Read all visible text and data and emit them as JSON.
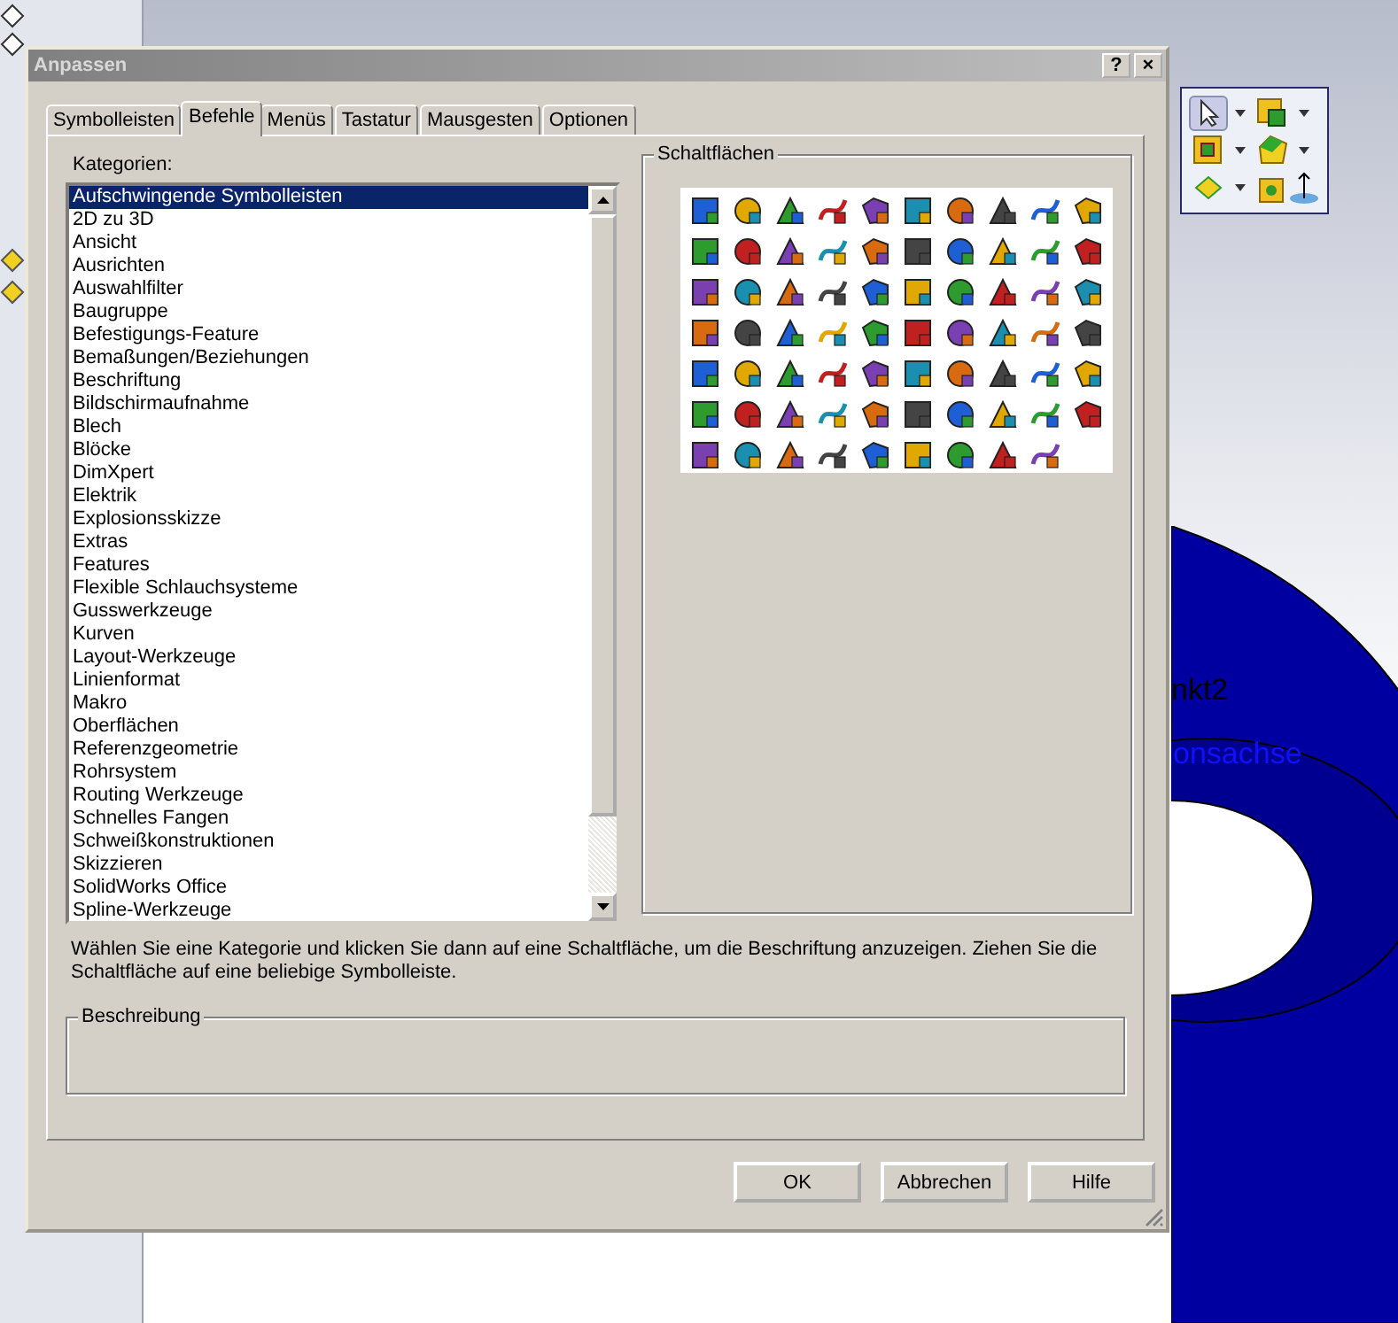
{
  "window": {
    "title": "Anpassen",
    "help_button": "?",
    "close_button": "×"
  },
  "tabs": [
    {
      "label": "Symbolleisten",
      "selected": false
    },
    {
      "label": "Befehle",
      "selected": true
    },
    {
      "label": "Menüs",
      "selected": false
    },
    {
      "label": "Tastatur",
      "selected": false
    },
    {
      "label": "Mausgesten",
      "selected": false
    },
    {
      "label": "Optionen",
      "selected": false
    }
  ],
  "categories_label": "Kategorien:",
  "categories": [
    {
      "label": "Aufschwingende Symbolleisten",
      "selected": true
    },
    {
      "label": "2D zu 3D",
      "selected": false
    },
    {
      "label": "Ansicht",
      "selected": false
    },
    {
      "label": "Ausrichten",
      "selected": false
    },
    {
      "label": "Auswahlfilter",
      "selected": false
    },
    {
      "label": "Baugruppe",
      "selected": false
    },
    {
      "label": "Befestigungs-Feature",
      "selected": false
    },
    {
      "label": "Bemaßungen/Beziehungen",
      "selected": false
    },
    {
      "label": "Beschriftung",
      "selected": false
    },
    {
      "label": "Bildschirmaufnahme",
      "selected": false
    },
    {
      "label": "Blech",
      "selected": false
    },
    {
      "label": "Blöcke",
      "selected": false
    },
    {
      "label": "DimXpert",
      "selected": false
    },
    {
      "label": "Elektrik",
      "selected": false
    },
    {
      "label": "Explosionsskizze",
      "selected": false
    },
    {
      "label": "Extras",
      "selected": false
    },
    {
      "label": "Features",
      "selected": false
    },
    {
      "label": "Flexible Schlauchsysteme",
      "selected": false
    },
    {
      "label": "Gusswerkzeuge",
      "selected": false
    },
    {
      "label": "Kurven",
      "selected": false
    },
    {
      "label": "Layout-Werkzeuge",
      "selected": false
    },
    {
      "label": "Linienformat",
      "selected": false
    },
    {
      "label": "Makro",
      "selected": false
    },
    {
      "label": "Oberflächen",
      "selected": false
    },
    {
      "label": "Referenzgeometrie",
      "selected": false
    },
    {
      "label": "Rohrsystem",
      "selected": false
    },
    {
      "label": "Routing Werkzeuge",
      "selected": false
    },
    {
      "label": "Schnelles Fangen",
      "selected": false
    },
    {
      "label": "Schweißkonstruktionen",
      "selected": false
    },
    {
      "label": "Skizzieren",
      "selected": false
    },
    {
      "label": "SolidWorks Office",
      "selected": false
    },
    {
      "label": "Spline-Werkzeuge",
      "selected": false
    }
  ],
  "buttons_group": {
    "title": "Schaltflächen"
  },
  "instructions": "Wählen Sie eine Kategorie und klicken Sie dann auf eine Schaltfläche, um die Beschriftung anzuzeigen. Ziehen Sie die Schaltfläche auf eine beliebige Symbolleiste.",
  "description_group": {
    "title": "Beschreibung"
  },
  "dialog_buttons": [
    "OK",
    "Abbrechen",
    "Hilfe"
  ],
  "viewport_labels": [
    "nkt2",
    "onsachse"
  ]
}
